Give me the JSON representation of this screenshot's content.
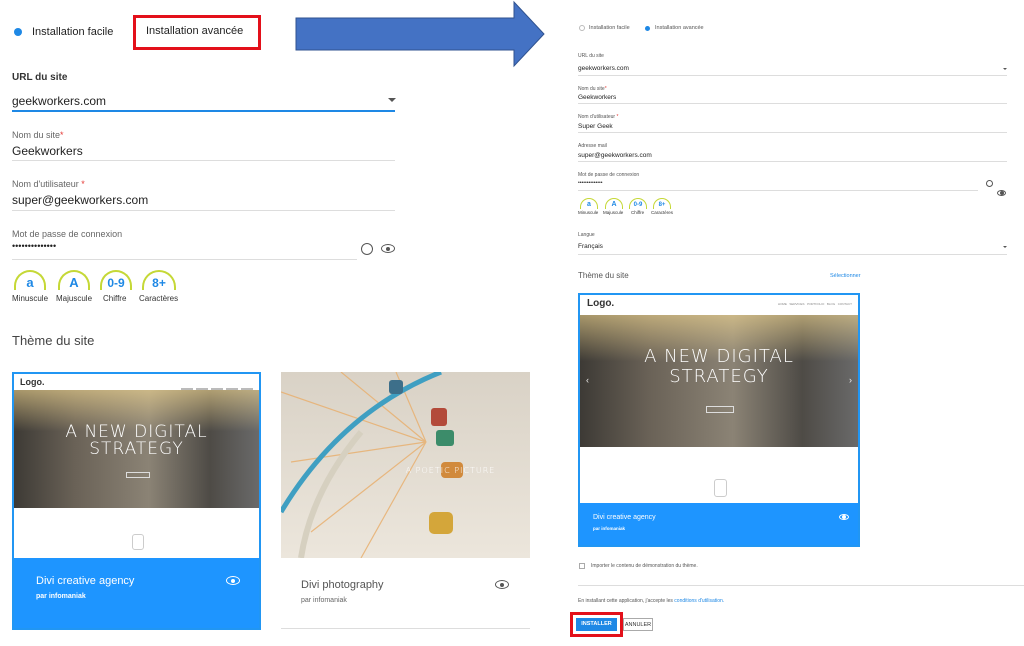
{
  "left": {
    "mode_easy": "Installation facile",
    "mode_advanced": "Installation avancée",
    "url_label": "URL du site",
    "url_value": "geekworkers.com",
    "site_name_label": "Nom du site",
    "site_name_value": "Geekworkers",
    "username_label": "Nom d'utilisateur",
    "username_value": "super@geekworkers.com",
    "password_label": "Mot de passe de connexion",
    "password_value": "••••••••••••••",
    "rules": [
      {
        "symbol": "a",
        "label": "Minuscule"
      },
      {
        "symbol": "A",
        "label": "Majuscule"
      },
      {
        "symbol": "0-9",
        "label": "Chiffre"
      },
      {
        "symbol": "8+",
        "label": "Caractères"
      }
    ],
    "theme_heading": "Thème du site",
    "themes": [
      {
        "logo": "Logo.",
        "hero": "A NEW DIGITAL STRATEGY",
        "name": "Divi creative agency",
        "author": "par infomaniak"
      },
      {
        "hero": "A POETIC PICTURE",
        "name": "Divi photography",
        "author": "par infomaniak"
      }
    ]
  },
  "right": {
    "mode_easy": "Installation facile",
    "mode_advanced": "Installation avancée",
    "url_label": "URL du site",
    "url_value": "geekworkers.com",
    "site_name_label": "Nom du site",
    "site_name_value": "Geekworkers",
    "username_label": "Nom d'utilisateur",
    "username_value": "Super Geek",
    "email_label": "Adresse mail",
    "email_value": "super@geekworkers.com",
    "password_label": "Mot de passe de connexion",
    "password_value": "••••••••••••••",
    "rules": [
      {
        "symbol": "a",
        "label": "Minuscule"
      },
      {
        "symbol": "A",
        "label": "Majuscule"
      },
      {
        "symbol": "0-9",
        "label": "Chiffre"
      },
      {
        "symbol": "8+",
        "label": "Caractères"
      }
    ],
    "language_label": "Langue",
    "language_value": "Français",
    "theme_heading": "Thème du site",
    "select_link": "Sélectionner",
    "theme": {
      "logo": "Logo.",
      "nav": [
        "HOME",
        "SERVICES",
        "PORTFOLIO",
        "BLOG",
        "CONTACT"
      ],
      "hero": "A NEW DIGITAL STRATEGY",
      "name": "Divi creative agency",
      "author": "par infomaniak"
    },
    "import_demo": "Importer le contenu de démonstration du thème.",
    "terms_prefix": "En installant cette application, j'accepte les",
    "terms_link": "conditions d'utilisation.",
    "install_button": "INSTALLER",
    "cancel_button": "ANNULER"
  },
  "colors": {
    "accent": "#1e88e5",
    "highlight": "#e3101a",
    "arrow": "#4472c4",
    "card_blue": "#1e95ff",
    "rule_arc": "#c5d836"
  }
}
